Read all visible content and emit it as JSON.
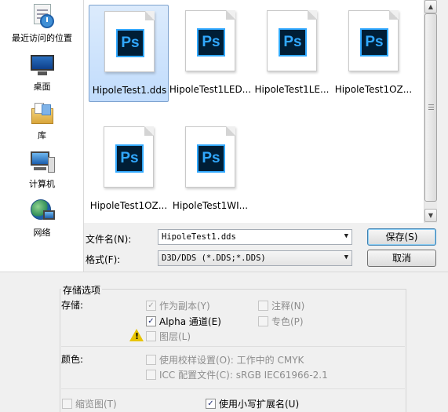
{
  "nav": {
    "items": [
      {
        "label": "最近访问的位置",
        "icon": "recent-places-icon"
      },
      {
        "label": "桌面",
        "icon": "desktop-icon"
      },
      {
        "label": "库",
        "icon": "library-icon"
      },
      {
        "label": "计算机",
        "icon": "computer-icon"
      },
      {
        "label": "网络",
        "icon": "network-icon"
      }
    ]
  },
  "files": [
    {
      "name": "HipoleTest1.dds",
      "icon_text": "Ps",
      "selected": true
    },
    {
      "name": "HipoleTest1LED...",
      "icon_text": "Ps"
    },
    {
      "name": "HipoleTest1LE...",
      "icon_text": "Ps"
    },
    {
      "name": "HipoleTest1OZ...",
      "icon_text": "Ps"
    },
    {
      "name": "HipoleTest1OZ...",
      "icon_text": "Ps"
    },
    {
      "name": "HipoleTest1WI...",
      "icon_text": "Ps"
    }
  ],
  "form": {
    "filename_label": "文件名(N):",
    "filename_value": "HipoleTest1.dds",
    "format_label": "格式(F):",
    "format_value": "D3D/DDS (*.DDS;*.DDS)",
    "save_button": "保存(S)",
    "cancel_button": "取消"
  },
  "options": {
    "group_title": "存储选项",
    "save_label": "存储:",
    "as_copy": "作为副本(Y)",
    "notes": "注释(N)",
    "alpha": "Alpha 通道(E)",
    "spot": "专色(P)",
    "layers": "图层(L)",
    "color_label": "颜色:",
    "use_proof": "使用校样设置(O):  工作中的 CMYK",
    "icc": "ICC 配置文件(C):  sRGB IEC61966-2.1",
    "thumbnail": "缩览图(T)",
    "lowercase_ext": "使用小写扩展名(U)"
  },
  "scrollbar": {
    "up_arrow": "▲",
    "down_arrow": "▼"
  },
  "colors": {
    "accent": "#31a8ff",
    "ps_bg": "#001e36",
    "selection": "#c1dcfc"
  }
}
